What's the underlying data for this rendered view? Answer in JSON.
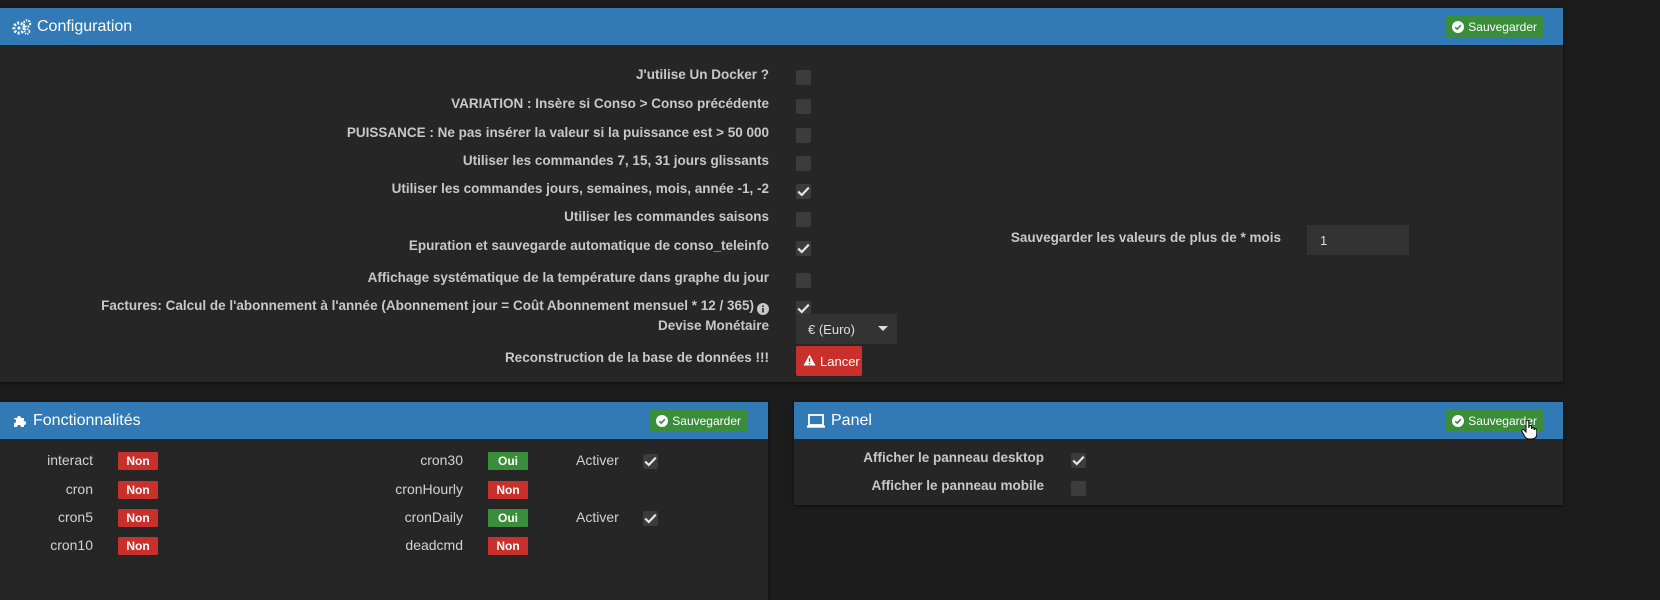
{
  "config": {
    "title": "Configuration",
    "save_label": "Sauvegarder",
    "rows": [
      {
        "label": "J'utilise Un Docker ?",
        "checked": false
      },
      {
        "label": "VARIATION : Insère si Conso > Conso précédente",
        "checked": false
      },
      {
        "label": "PUISSANCE : Ne pas insérer la valeur si la puissance est > 50 000",
        "checked": false
      },
      {
        "label": "Utiliser les commandes 7, 15, 31 jours glissants",
        "checked": false
      },
      {
        "label": "Utiliser les commandes jours, semaines, mois, année -1, -2",
        "checked": true
      },
      {
        "label": "Utiliser les commandes saisons",
        "checked": false
      },
      {
        "label": "Epuration et sauvegarde automatique de conso_teleinfo",
        "checked": true
      },
      {
        "label": "Affichage systématique de la température dans graphe du jour",
        "checked": false
      },
      {
        "label": "Factures: Calcul de l'abonnement à l'année (Abonnement jour = Coût Abonnement mensuel * 12 / 365)",
        "checked": true
      }
    ],
    "retention_label": "Sauvegarder les valeurs de plus de * mois",
    "retention_value": "1",
    "currency_label": "Devise Monétaire",
    "currency_value": "€ (Euro)",
    "rebuild_label": "Reconstruction de la base de données !!!",
    "rebuild_button": "Lancer"
  },
  "features": {
    "title": "Fonctionnalités",
    "save_label": "Sauvegarder",
    "left": [
      {
        "name": "interact",
        "status": "Non"
      },
      {
        "name": "cron",
        "status": "Non"
      },
      {
        "name": "cron5",
        "status": "Non"
      },
      {
        "name": "cron10",
        "status": "Non"
      }
    ],
    "right": [
      {
        "name": "cron30",
        "status": "Oui",
        "activer": "Activer",
        "checked": true
      },
      {
        "name": "cronHourly",
        "status": "Non",
        "activer": "",
        "checked": false
      },
      {
        "name": "cronDaily",
        "status": "Oui",
        "activer": "Activer",
        "checked": true
      },
      {
        "name": "deadcmd",
        "status": "Non",
        "activer": "",
        "checked": false
      }
    ]
  },
  "panel": {
    "title": "Panel",
    "save_label": "Sauvegarder",
    "rows": [
      {
        "label": "Afficher le panneau desktop",
        "checked": true
      },
      {
        "label": "Afficher le panneau mobile",
        "checked": false
      }
    ]
  },
  "colors": {
    "header_blue": "#317ab6",
    "success_green": "#3a8d3a",
    "danger_red": "#c9302c",
    "panel_bg": "#262626",
    "page_bg": "#1c1c1c"
  }
}
